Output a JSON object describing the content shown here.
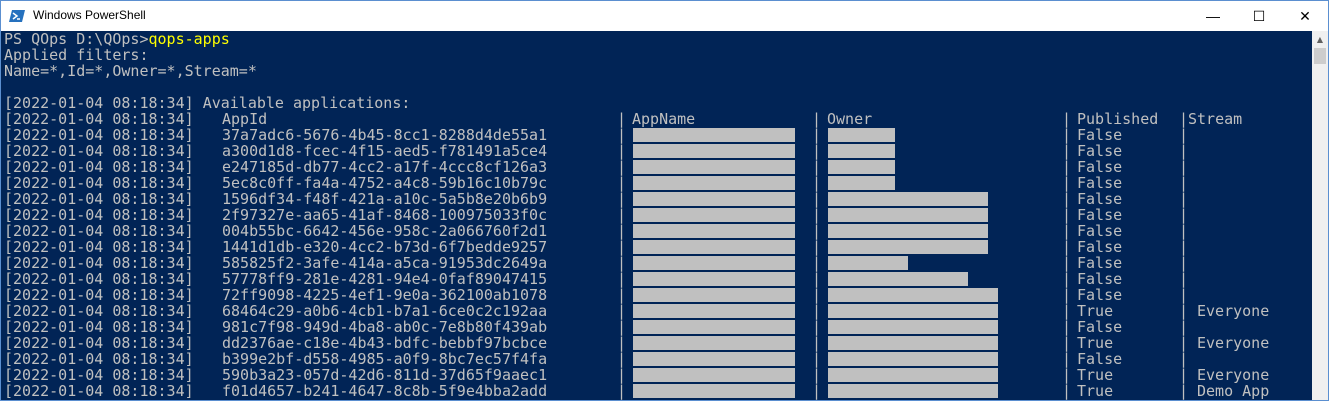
{
  "window": {
    "title": "Windows PowerShell",
    "minimize_glyph": "—",
    "maximize_glyph": "☐",
    "close_glyph": "✕"
  },
  "console": {
    "prompt": "PS QOps D:\\QOps>",
    "command": "qops-apps",
    "lines_top": [
      "Applied filters:",
      "Name=*,Id=*,Owner=*,Stream=*",
      ""
    ],
    "timestamp": "[2022-01-04 08:18:34]",
    "available_label": "Available applications:",
    "headers": {
      "appid": "AppId",
      "appname": "AppName",
      "owner": "Owner",
      "published": "Published",
      "stream": "Stream"
    },
    "separator": "|",
    "rows": [
      {
        "appid": "37a7adc6-5676-4b45-8cc1-8288d4de55a1",
        "published": "False",
        "stream": ""
      },
      {
        "appid": "a300d1d8-fcec-4f15-aed5-f781491a5ce4",
        "published": "False",
        "stream": ""
      },
      {
        "appid": "e247185d-db77-4cc2-a17f-4ccc8cf126a3",
        "published": "False",
        "stream": ""
      },
      {
        "appid": "5ec8c0ff-fa4a-4752-a4c8-59b16c10b79c",
        "published": "False",
        "stream": ""
      },
      {
        "appid": "1596df34-f48f-421a-a10c-5a5b8e20b6b9",
        "published": "False",
        "stream": ""
      },
      {
        "appid": "2f97327e-aa65-41af-8468-100975033f0c",
        "published": "False",
        "stream": ""
      },
      {
        "appid": "004b55bc-6642-456e-958c-2a066760f2d1",
        "published": "False",
        "stream": ""
      },
      {
        "appid": "1441d1db-e320-4cc2-b73d-6f7bedde9257",
        "published": "False",
        "stream": ""
      },
      {
        "appid": "585825f2-3afe-414a-a5ca-91953dc2649a",
        "published": "False",
        "stream": ""
      },
      {
        "appid": "57778ff9-281e-4281-94e4-0faf89047415",
        "published": "False",
        "stream": ""
      },
      {
        "appid": "72ff9098-4225-4ef1-9e0a-362100ab1078",
        "published": "False",
        "stream": ""
      },
      {
        "appid": "68464c29-a0b6-4cb1-b7a1-6ce0c2c192aa",
        "published": "True",
        "stream": "Everyone"
      },
      {
        "appid": "981c7f98-949d-4ba8-ab0c-7e8b80f439ab",
        "published": "False",
        "stream": ""
      },
      {
        "appid": "dd2376ae-c18e-4b43-bdfc-bebbf97bcbce",
        "published": "True",
        "stream": "Everyone"
      },
      {
        "appid": "b399e2bf-d558-4985-a0f9-8bc7ec57f4fa",
        "published": "False",
        "stream": ""
      },
      {
        "appid": "590b3a23-057d-42d6-811d-37d65f9aaec1",
        "published": "True",
        "stream": "Everyone"
      },
      {
        "appid": "f01d4657-b241-4647-8c8b-5f9e4bba2add",
        "published": "True",
        "stream": "Demo App"
      }
    ]
  },
  "colors": {
    "background": "#012456",
    "text": "#c0c0c0",
    "command": "#ffff00",
    "redaction": "#c0c0c0"
  },
  "scrollbar": {
    "up_arrow": "▲"
  }
}
